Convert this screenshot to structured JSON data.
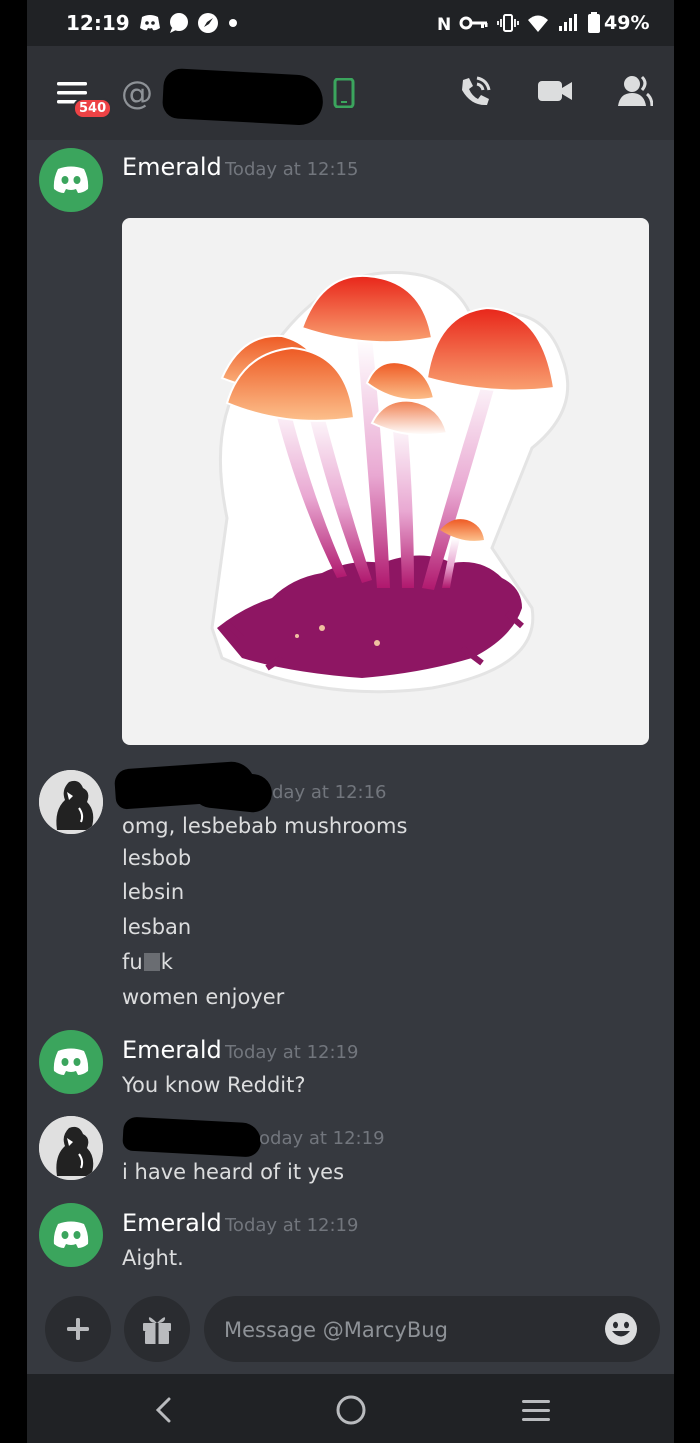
{
  "status_bar": {
    "time": "12:19",
    "battery_percent": "49%",
    "icons_left": [
      "discord-icon",
      "chat-bubble-icon",
      "compass-icon",
      "dot-icon"
    ],
    "icons_right": [
      "nfc-icon",
      "vpn-key-icon",
      "vibrate-icon",
      "wifi-icon",
      "signal-icon",
      "battery-icon"
    ]
  },
  "header": {
    "unread_badge": "540",
    "at_symbol": "@"
  },
  "messages": [
    {
      "author": "Emerald",
      "timestamp": "Today at 12:15",
      "lines": [],
      "has_image": true
    },
    {
      "author": "",
      "timestamp": "day at 12:16",
      "lines": [
        "omg, lesbebab mushrooms",
        "lesbob",
        "lebsin",
        "lesban",
        "fu",
        "k",
        "women enjoyer"
      ]
    },
    {
      "author": "Emerald",
      "timestamp": "Today at 12:19",
      "lines": [
        "You know Reddit?"
      ]
    },
    {
      "author": "",
      "timestamp": "oday at 12:19",
      "lines": [
        "i have heard of it yes"
      ]
    },
    {
      "author": "Emerald",
      "timestamp": "Today at 12:19",
      "lines": [
        "Aight."
      ]
    }
  ],
  "input": {
    "placeholder": "Message @MarcyBug"
  },
  "colors": {
    "background": "#36393f",
    "header": "#2f3136",
    "discord_green": "#3ba55d",
    "badge_red": "#ed4245",
    "timestamp_gray": "#72767d"
  }
}
